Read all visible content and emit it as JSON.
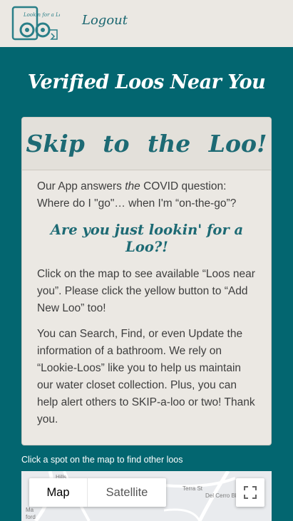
{
  "header": {
    "logo_text": "Lookin for a Loo",
    "logout_label": "Logout"
  },
  "hero": {
    "title": "Verified Loos Near You"
  },
  "card": {
    "title": "Skip to the Loo!",
    "intro_part1": "Our App answers ",
    "intro_emphasis": "the",
    "intro_part2": " COVID question: Where do I \"go\"… when I'm “on-the-go”?",
    "subtitle": "Are you just lookin' for a Loo?!",
    "paragraph2": "Click on the map to see available “Loos near you”.   Please click the yellow button to “Add New Loo” too!",
    "paragraph3": "You can Search, Find, or even Update the information of a bathroom. We rely on “Lookie-Loos” like you to help us maintain our water closet collection. Plus, you can help alert others to SKIP-a-loo or two! Thank you."
  },
  "map_section": {
    "caption": "Click a spot on the map to find other loos",
    "map_type_options": [
      "Map",
      "Satellite"
    ],
    "selected_map_type": "Map",
    "street_labels": [
      "Hills",
      "Terra St",
      "Del Cerro Blvd",
      "Ma",
      "ford"
    ]
  },
  "colors": {
    "teal_background": "#036670",
    "cream": "#ebe8e3",
    "accent_text": "#1d6a74"
  }
}
